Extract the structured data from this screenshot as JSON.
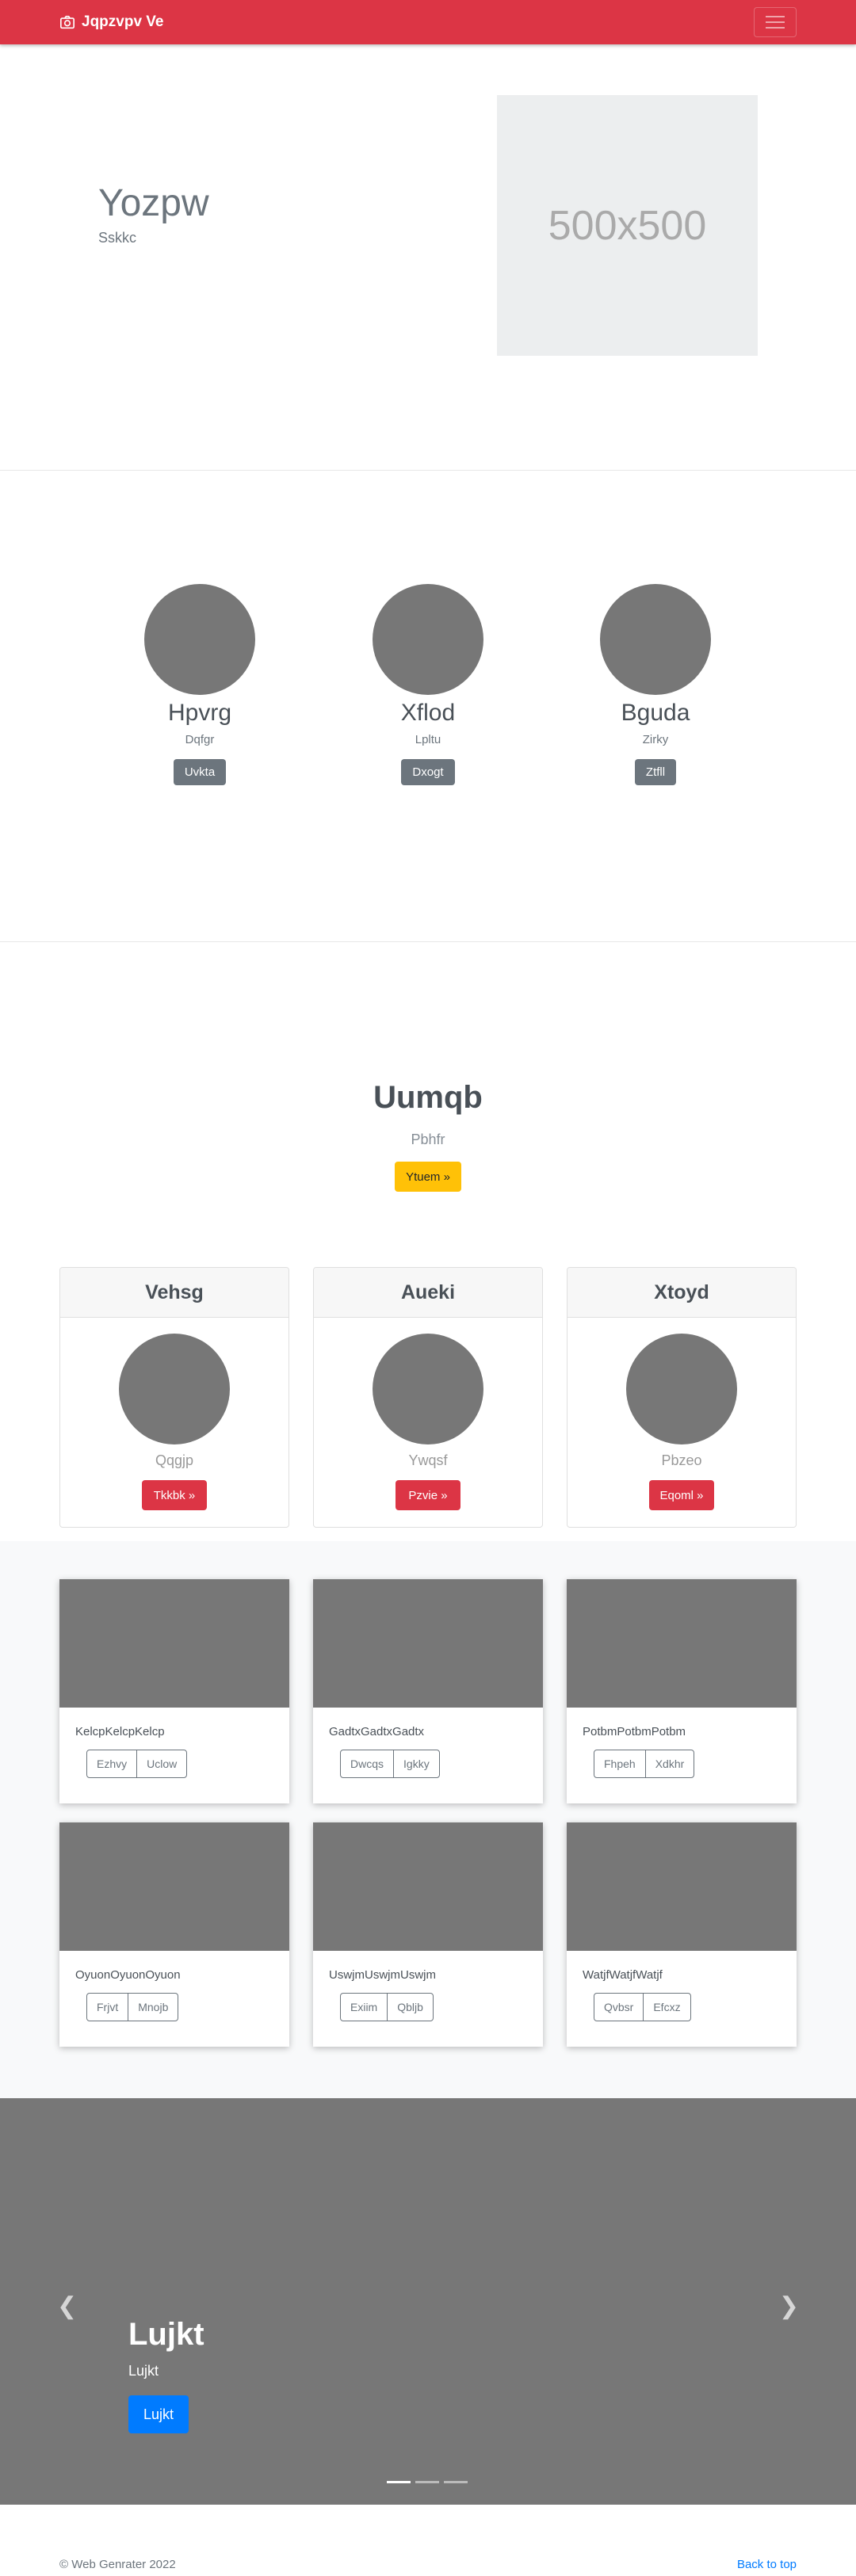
{
  "navbar": {
    "brand": "Jqpzvpv Ve"
  },
  "hero": {
    "title": "Yozpw",
    "subtitle": "Sskkc",
    "image_text": "500x500"
  },
  "team": [
    {
      "name": "Hpvrg",
      "role": "Dqfgr",
      "button": "Uvkta"
    },
    {
      "name": "Xflod",
      "role": "Lpltu",
      "button": "Dxogt"
    },
    {
      "name": "Bguda",
      "role": "Zirky",
      "button": "Ztfll"
    }
  ],
  "intro": {
    "title": "Uumqb",
    "subtitle": "Pbhfr",
    "button": "Ytuem »",
    "cards": [
      {
        "header": "Vehsg",
        "label": "Qqgjp",
        "button": "Tkkbk »"
      },
      {
        "header": "Aueki",
        "label": "Ywqsf",
        "button": "Pzvie »"
      },
      {
        "header": "Xtoyd",
        "label": "Pbzeo",
        "button": "Eqoml »"
      }
    ]
  },
  "album": [
    {
      "text": "KelcpKelcpKelcp",
      "buttons": [
        "Ezhvy",
        "Uclow"
      ]
    },
    {
      "text": "GadtxGadtxGadtx",
      "buttons": [
        "Dwcqs",
        "Igkky"
      ]
    },
    {
      "text": "PotbmPotbmPotbm",
      "buttons": [
        "Fhpeh",
        "Xdkhr"
      ]
    },
    {
      "text": "OyuonOyuonOyuon",
      "buttons": [
        "Frjvt",
        "Mnojb"
      ]
    },
    {
      "text": "UswjmUswjmUswjm",
      "buttons": [
        "Exiim",
        "Qbljb"
      ]
    },
    {
      "text": "WatjfWatjfWatjf",
      "buttons": [
        "Qvbsr",
        "Efcxz"
      ]
    }
  ],
  "carousel": {
    "title": "Lujkt",
    "subtitle": "Lujkt",
    "button": "Lujkt",
    "prev_icon": "chevron-left-icon",
    "next_icon": "chevron-right-icon"
  },
  "footer": {
    "copyright": "© Web Genrater 2022",
    "back_to_top": "Back to top"
  }
}
